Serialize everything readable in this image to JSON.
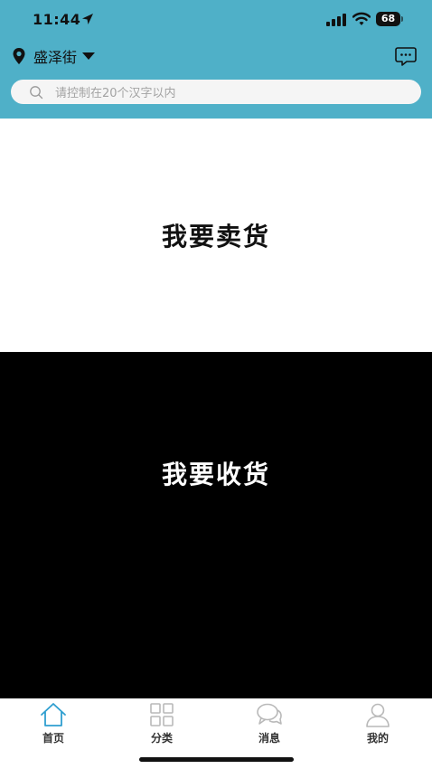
{
  "status_bar": {
    "time": "11:44",
    "battery": "68"
  },
  "header": {
    "location": "盛泽街",
    "search_placeholder": "请控制在20个汉字以内"
  },
  "panels": {
    "sell": "我要卖货",
    "receive": "我要收货"
  },
  "tabs": [
    {
      "label": "首页",
      "icon": "home-icon",
      "active": true
    },
    {
      "label": "分类",
      "icon": "grid-icon",
      "active": false
    },
    {
      "label": "消息",
      "icon": "chat-bubbles-icon",
      "active": false
    },
    {
      "label": "我的",
      "icon": "user-icon",
      "active": false
    }
  ],
  "colors": {
    "header": "#4fb0c8",
    "tab_active": "#2f9fd0",
    "tab_inactive": "#b9b9b9"
  }
}
